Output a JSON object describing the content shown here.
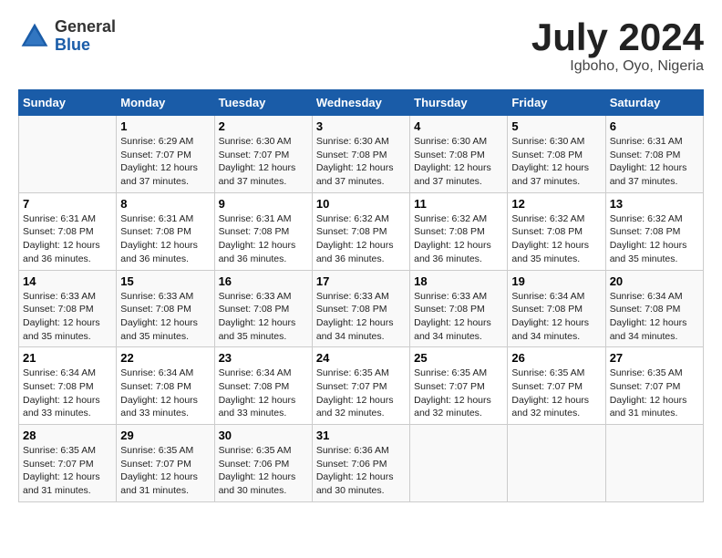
{
  "header": {
    "logo": {
      "general": "General",
      "blue": "Blue"
    },
    "title": "July 2024",
    "location": "Igboho, Oyo, Nigeria"
  },
  "calendar": {
    "days_of_week": [
      "Sunday",
      "Monday",
      "Tuesday",
      "Wednesday",
      "Thursday",
      "Friday",
      "Saturday"
    ],
    "weeks": [
      [
        {
          "day": "",
          "info": ""
        },
        {
          "day": "1",
          "info": "Sunrise: 6:29 AM\nSunset: 7:07 PM\nDaylight: 12 hours\nand 37 minutes."
        },
        {
          "day": "2",
          "info": "Sunrise: 6:30 AM\nSunset: 7:07 PM\nDaylight: 12 hours\nand 37 minutes."
        },
        {
          "day": "3",
          "info": "Sunrise: 6:30 AM\nSunset: 7:08 PM\nDaylight: 12 hours\nand 37 minutes."
        },
        {
          "day": "4",
          "info": "Sunrise: 6:30 AM\nSunset: 7:08 PM\nDaylight: 12 hours\nand 37 minutes."
        },
        {
          "day": "5",
          "info": "Sunrise: 6:30 AM\nSunset: 7:08 PM\nDaylight: 12 hours\nand 37 minutes."
        },
        {
          "day": "6",
          "info": "Sunrise: 6:31 AM\nSunset: 7:08 PM\nDaylight: 12 hours\nand 37 minutes."
        }
      ],
      [
        {
          "day": "7",
          "info": "Sunrise: 6:31 AM\nSunset: 7:08 PM\nDaylight: 12 hours\nand 36 minutes."
        },
        {
          "day": "8",
          "info": "Sunrise: 6:31 AM\nSunset: 7:08 PM\nDaylight: 12 hours\nand 36 minutes."
        },
        {
          "day": "9",
          "info": "Sunrise: 6:31 AM\nSunset: 7:08 PM\nDaylight: 12 hours\nand 36 minutes."
        },
        {
          "day": "10",
          "info": "Sunrise: 6:32 AM\nSunset: 7:08 PM\nDaylight: 12 hours\nand 36 minutes."
        },
        {
          "day": "11",
          "info": "Sunrise: 6:32 AM\nSunset: 7:08 PM\nDaylight: 12 hours\nand 36 minutes."
        },
        {
          "day": "12",
          "info": "Sunrise: 6:32 AM\nSunset: 7:08 PM\nDaylight: 12 hours\nand 35 minutes."
        },
        {
          "day": "13",
          "info": "Sunrise: 6:32 AM\nSunset: 7:08 PM\nDaylight: 12 hours\nand 35 minutes."
        }
      ],
      [
        {
          "day": "14",
          "info": "Sunrise: 6:33 AM\nSunset: 7:08 PM\nDaylight: 12 hours\nand 35 minutes."
        },
        {
          "day": "15",
          "info": "Sunrise: 6:33 AM\nSunset: 7:08 PM\nDaylight: 12 hours\nand 35 minutes."
        },
        {
          "day": "16",
          "info": "Sunrise: 6:33 AM\nSunset: 7:08 PM\nDaylight: 12 hours\nand 35 minutes."
        },
        {
          "day": "17",
          "info": "Sunrise: 6:33 AM\nSunset: 7:08 PM\nDaylight: 12 hours\nand 34 minutes."
        },
        {
          "day": "18",
          "info": "Sunrise: 6:33 AM\nSunset: 7:08 PM\nDaylight: 12 hours\nand 34 minutes."
        },
        {
          "day": "19",
          "info": "Sunrise: 6:34 AM\nSunset: 7:08 PM\nDaylight: 12 hours\nand 34 minutes."
        },
        {
          "day": "20",
          "info": "Sunrise: 6:34 AM\nSunset: 7:08 PM\nDaylight: 12 hours\nand 34 minutes."
        }
      ],
      [
        {
          "day": "21",
          "info": "Sunrise: 6:34 AM\nSunset: 7:08 PM\nDaylight: 12 hours\nand 33 minutes."
        },
        {
          "day": "22",
          "info": "Sunrise: 6:34 AM\nSunset: 7:08 PM\nDaylight: 12 hours\nand 33 minutes."
        },
        {
          "day": "23",
          "info": "Sunrise: 6:34 AM\nSunset: 7:08 PM\nDaylight: 12 hours\nand 33 minutes."
        },
        {
          "day": "24",
          "info": "Sunrise: 6:35 AM\nSunset: 7:07 PM\nDaylight: 12 hours\nand 32 minutes."
        },
        {
          "day": "25",
          "info": "Sunrise: 6:35 AM\nSunset: 7:07 PM\nDaylight: 12 hours\nand 32 minutes."
        },
        {
          "day": "26",
          "info": "Sunrise: 6:35 AM\nSunset: 7:07 PM\nDaylight: 12 hours\nand 32 minutes."
        },
        {
          "day": "27",
          "info": "Sunrise: 6:35 AM\nSunset: 7:07 PM\nDaylight: 12 hours\nand 31 minutes."
        }
      ],
      [
        {
          "day": "28",
          "info": "Sunrise: 6:35 AM\nSunset: 7:07 PM\nDaylight: 12 hours\nand 31 minutes."
        },
        {
          "day": "29",
          "info": "Sunrise: 6:35 AM\nSunset: 7:07 PM\nDaylight: 12 hours\nand 31 minutes."
        },
        {
          "day": "30",
          "info": "Sunrise: 6:35 AM\nSunset: 7:06 PM\nDaylight: 12 hours\nand 30 minutes."
        },
        {
          "day": "31",
          "info": "Sunrise: 6:36 AM\nSunset: 7:06 PM\nDaylight: 12 hours\nand 30 minutes."
        },
        {
          "day": "",
          "info": ""
        },
        {
          "day": "",
          "info": ""
        },
        {
          "day": "",
          "info": ""
        }
      ]
    ]
  }
}
